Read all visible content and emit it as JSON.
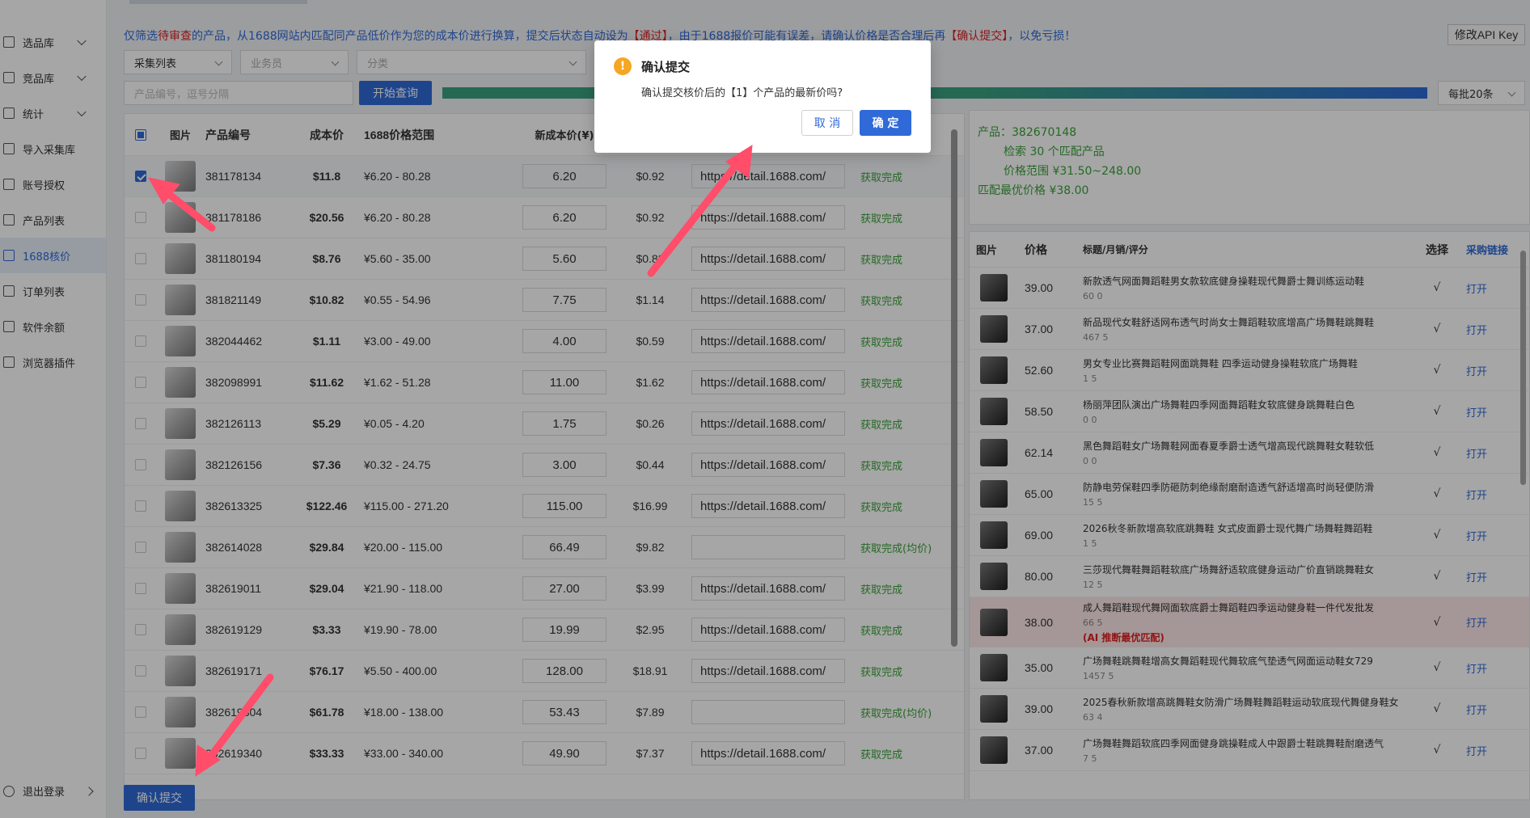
{
  "sidebar": {
    "items": [
      {
        "label": "选品库",
        "icon": "grid-icon",
        "chevron": true
      },
      {
        "label": "竞品库",
        "icon": "shop-icon",
        "chevron": true
      },
      {
        "label": "统计",
        "icon": "chart-icon",
        "chevron": true
      },
      {
        "label": "导入采集库",
        "icon": "import-icon",
        "chevron": false
      },
      {
        "label": "账号授权",
        "icon": "user-icon",
        "chevron": false
      },
      {
        "label": "产品列表",
        "icon": "list-icon",
        "chevron": false
      },
      {
        "label": "1688核价",
        "icon": "price-check-icon",
        "chevron": false,
        "active": true
      },
      {
        "label": "订单列表",
        "icon": "order-icon",
        "chevron": false
      },
      {
        "label": "软件余额",
        "icon": "wallet-icon",
        "chevron": false
      },
      {
        "label": "浏览器插件",
        "icon": "plugin-icon",
        "chevron": false
      }
    ],
    "logout": "退出登录"
  },
  "notice": {
    "p1": "仅筛选",
    "p2": "待审查",
    "p3": "的产品，从1688网站内匹配同产品低价作为您的成本价进行换算，提交后状态自动设为",
    "p4": "【通过】",
    "p5": "，由于1688报价可能有误差，请确认价格是否合理后再",
    "p6": "【确认提交】",
    "p7": "，以免亏损！"
  },
  "api_button": "修改API Key",
  "filters": {
    "collect": "采集列表",
    "staff": "业务员",
    "category": "分类",
    "search_placeholder": "产品编号，逗号分隔",
    "search_button": "开始查询",
    "batch": "每批20条",
    "progress_fraction": 1.0
  },
  "left_table": {
    "headers": {
      "img": "图片",
      "id": "产品编号",
      "cost": "成本价",
      "range": "1688价格范围",
      "new_cost": "新成本价(¥)"
    },
    "rows": [
      {
        "id": "381178134",
        "cost": "$11.8",
        "range": "¥6.20 - 80.28",
        "new": "6.20",
        "usd": "$0.92",
        "link": "https://detail.1688.com/",
        "status": "获取完成",
        "checked": true
      },
      {
        "id": "381178186",
        "cost": "$20.56",
        "range": "¥6.20 - 80.28",
        "new": "6.20",
        "usd": "$0.92",
        "link": "https://detail.1688.com/",
        "status": "获取完成"
      },
      {
        "id": "381180194",
        "cost": "$8.76",
        "range": "¥5.60 - 35.00",
        "new": "5.60",
        "usd": "$0.83",
        "link": "https://detail.1688.com/",
        "status": "获取完成"
      },
      {
        "id": "381821149",
        "cost": "$10.82",
        "range": "¥0.55 - 54.96",
        "new": "7.75",
        "usd": "$1.14",
        "link": "https://detail.1688.com/",
        "status": "获取完成"
      },
      {
        "id": "382044462",
        "cost": "$1.11",
        "range": "¥3.00 - 49.00",
        "new": "4.00",
        "usd": "$0.59",
        "link": "https://detail.1688.com/",
        "status": "获取完成"
      },
      {
        "id": "382098991",
        "cost": "$11.62",
        "range": "¥1.62 - 51.28",
        "new": "11.00",
        "usd": "$1.62",
        "link": "https://detail.1688.com/",
        "status": "获取完成"
      },
      {
        "id": "382126113",
        "cost": "$5.29",
        "range": "¥0.05 - 4.20",
        "new": "1.75",
        "usd": "$0.26",
        "link": "https://detail.1688.com/",
        "status": "获取完成"
      },
      {
        "id": "382126156",
        "cost": "$7.36",
        "range": "¥0.32 - 24.75",
        "new": "3.00",
        "usd": "$0.44",
        "link": "https://detail.1688.com/",
        "status": "获取完成"
      },
      {
        "id": "382613325",
        "cost": "$122.46",
        "range": "¥115.00 - 271.20",
        "new": "115.00",
        "usd": "$16.99",
        "link": "https://detail.1688.com/",
        "status": "获取完成"
      },
      {
        "id": "382614028",
        "cost": "$29.84",
        "range": "¥20.00 - 115.00",
        "new": "66.49",
        "usd": "$9.82",
        "link": "",
        "status": "获取完成(均价)"
      },
      {
        "id": "382619011",
        "cost": "$29.04",
        "range": "¥21.90 - 118.00",
        "new": "27.00",
        "usd": "$3.99",
        "link": "https://detail.1688.com/",
        "status": "获取完成"
      },
      {
        "id": "382619129",
        "cost": "$3.33",
        "range": "¥19.90 - 78.00",
        "new": "19.99",
        "usd": "$2.95",
        "link": "https://detail.1688.com/",
        "status": "获取完成"
      },
      {
        "id": "382619171",
        "cost": "$76.17",
        "range": "¥5.50 - 400.00",
        "new": "128.00",
        "usd": "$18.91",
        "link": "https://detail.1688.com/",
        "status": "获取完成"
      },
      {
        "id": "382619304",
        "cost": "$61.78",
        "range": "¥18.00 - 138.00",
        "new": "53.43",
        "usd": "$7.89",
        "link": "",
        "status": "获取完成(均价)"
      },
      {
        "id": "382619340",
        "cost": "$33.33",
        "range": "¥33.00 - 340.00",
        "new": "49.90",
        "usd": "$7.37",
        "link": "https://detail.1688.com/",
        "status": "获取完成"
      }
    ]
  },
  "right_info": {
    "product": "产品：382670148",
    "found": "检索 30 个匹配产品",
    "range": "价格范围 ¥31.50~248.00",
    "best": "匹配最优价格 ¥38.00"
  },
  "right_table": {
    "headers": {
      "img": "图片",
      "price": "价格",
      "title": "标题/月销/评分",
      "select": "选择",
      "link": "采购链接"
    },
    "rows": [
      {
        "price": "39.00",
        "title": "新款透气网面舞蹈鞋男女款软底健身操鞋现代舞爵士舞训练运动鞋",
        "meta": "60 0",
        "sel": "√",
        "open": "打开"
      },
      {
        "price": "37.00",
        "title": "新品现代女鞋舒适网布透气时尚女士舞蹈鞋软底增高广场舞鞋跳舞鞋",
        "meta": "467 5",
        "sel": "√",
        "open": "打开"
      },
      {
        "price": "52.60",
        "title": "男女专业比赛舞蹈鞋网面跳舞鞋 四季运动健身操鞋软底广场舞鞋",
        "meta": "1 5",
        "sel": "√",
        "open": "打开"
      },
      {
        "price": "58.50",
        "title": "杨丽萍团队演出广场舞鞋四季网面舞蹈鞋女软底健身跳舞鞋白色",
        "meta": "0 0",
        "sel": "√",
        "open": "打开"
      },
      {
        "price": "62.14",
        "title": "黑色舞蹈鞋女广场舞鞋网面春夏季爵士透气增高现代跳舞鞋女鞋软低",
        "meta": "0 0",
        "sel": "√",
        "open": "打开"
      },
      {
        "price": "65.00",
        "title": "防静电劳保鞋四季防砸防刺绝缘耐磨耐造透气舒适增高时尚轻便防滑",
        "meta": "15 5",
        "sel": "√",
        "open": "打开"
      },
      {
        "price": "69.00",
        "title": "2026秋冬新款增高软底跳舞鞋 女式皮面爵士现代舞广场舞鞋舞蹈鞋",
        "meta": "1 5",
        "sel": "√",
        "open": "打开"
      },
      {
        "price": "80.00",
        "title": "三莎现代舞鞋舞蹈鞋软底广场舞舒适软底健身运动广价直销跳舞鞋女",
        "meta": "12 5",
        "sel": "√",
        "open": "打开"
      },
      {
        "price": "38.00",
        "title": "成人舞蹈鞋现代舞网面软底爵士舞蹈鞋四季运动健身鞋一件代发批发",
        "meta": "66 5",
        "ai": "(AI 推断最优匹配)",
        "sel": "√",
        "open": "打开",
        "highlight": true
      },
      {
        "price": "35.00",
        "title": "广场舞鞋跳舞鞋增高女舞蹈鞋现代舞软底气垫透气网面运动鞋女729",
        "meta": "1457 5",
        "sel": "√",
        "open": "打开"
      },
      {
        "price": "39.00",
        "title": "2025春秋新款增高跳舞鞋女防滑广场舞鞋舞蹈鞋运动软底现代舞健身鞋女",
        "meta": "63 4",
        "sel": "√",
        "open": "打开"
      },
      {
        "price": "37.00",
        "title": "广场舞鞋舞蹈软底四季网面健身跳操鞋成人中跟爵士鞋跳舞鞋耐磨透气",
        "meta": "7 5",
        "sel": "√",
        "open": "打开"
      }
    ]
  },
  "submit_button": "确认提交",
  "dialog": {
    "title": "确认提交",
    "message": "确认提交核价后的【1】个产品的最新价吗?",
    "cancel": "取 消",
    "ok": "确 定",
    "icon": "warning-icon"
  },
  "colors": {
    "primary": "#2f6ad8",
    "success": "#3aa13a",
    "danger": "#e02020",
    "warning": "#f5a623",
    "annotation_arrow": "#ff4d6a"
  }
}
